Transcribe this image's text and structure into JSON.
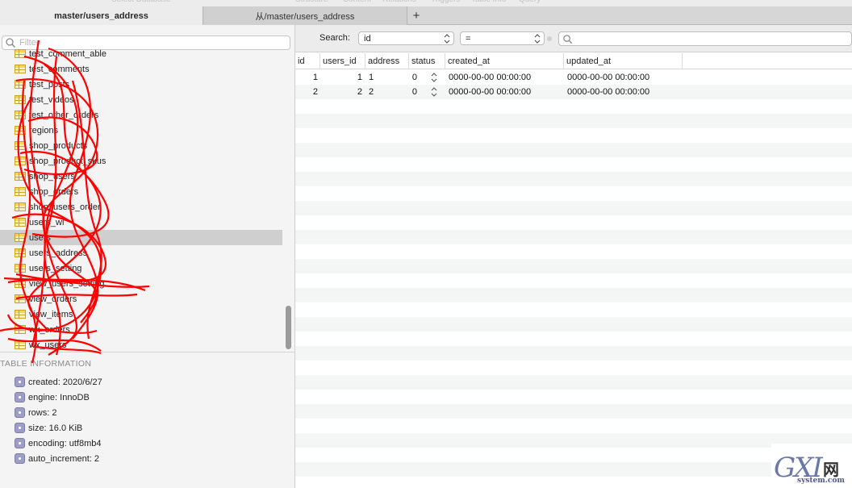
{
  "toolbar_faded": [
    "Select Database",
    "Structure",
    "Content",
    "Relations",
    "Triggers",
    "Table Info",
    "Query"
  ],
  "tabs": [
    {
      "label": "master/users_address",
      "active": true
    },
    {
      "label": "从/master/users_address",
      "active": false
    }
  ],
  "tab_add_label": "+",
  "sidebar": {
    "filter_placeholder": "Filter",
    "tables": [
      {
        "label": "test_comment_able",
        "selected": false
      },
      {
        "label": "test_comments",
        "selected": false
      },
      {
        "label": "test_posts",
        "selected": false
      },
      {
        "label": "test_videos",
        "selected": false
      },
      {
        "label": "test_other_orders",
        "selected": false
      },
      {
        "label": "regions",
        "selected": false
      },
      {
        "label": "shop_products",
        "selected": false
      },
      {
        "label": "shop_product_skus",
        "selected": false
      },
      {
        "label": "shop_users",
        "selected": false
      },
      {
        "label": "shop_orders",
        "selected": false
      },
      {
        "label": "shop_users_order",
        "selected": false
      },
      {
        "label": "users_wi",
        "selected": false
      },
      {
        "label": "users",
        "selected": true
      },
      {
        "label": "users_address",
        "selected": false
      },
      {
        "label": "users_setting",
        "selected": false
      },
      {
        "label": "view_users_setting",
        "selected": false
      },
      {
        "label": "view_orders",
        "selected": false
      },
      {
        "label": "view_items",
        "selected": false
      },
      {
        "label": "wx_orders",
        "selected": false
      },
      {
        "label": "wx_users",
        "selected": false
      }
    ],
    "info_title": "TABLE INFORMATION",
    "info": [
      "created: 2020/6/27",
      "engine: InnoDB",
      "rows: 2",
      "size: 16.0 KiB",
      "encoding: utf8mb4",
      "auto_increment: 2"
    ]
  },
  "search": {
    "label": "Search:",
    "field": "id",
    "operator": "=",
    "value": ""
  },
  "grid": {
    "columns": [
      "id",
      "users_id",
      "address",
      "status",
      "created_at",
      "updated_at"
    ],
    "rows": [
      {
        "id": "1",
        "users_id": "1",
        "address": "1",
        "status": "0",
        "created_at": "0000-00-00 00:00:00",
        "updated_at": "0000-00-00 00:00:00"
      },
      {
        "id": "2",
        "users_id": "2",
        "address": "2",
        "status": "0",
        "created_at": "0000-00-00 00:00:00",
        "updated_at": "0000-00-00 00:00:00"
      }
    ]
  },
  "watermark": {
    "logo": "GXI",
    "net": "网",
    "domain": "system.com"
  }
}
